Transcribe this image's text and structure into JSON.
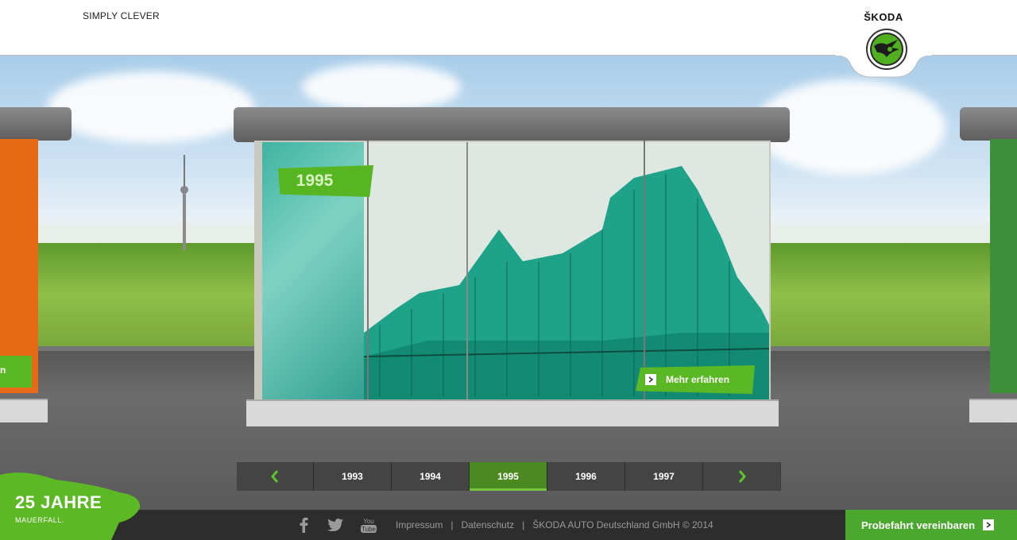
{
  "header": {
    "tagline": "SIMPLY CLEVER",
    "brand": "ŠKODA",
    "emblem_icon": "skoda-winged-arrow-icon"
  },
  "hero": {
    "year": "1995",
    "more_label": "Mehr erfahren",
    "left_tag": "n",
    "accent": "#56b520"
  },
  "year_nav": {
    "prev_icon": "chevron-left-icon",
    "next_icon": "chevron-right-icon",
    "years": [
      "1993",
      "1994",
      "1995",
      "1996",
      "1997"
    ],
    "active": "1995"
  },
  "badge": {
    "title": "25 JAHRE",
    "subtitle": "MAUERFALL."
  },
  "footer": {
    "social": [
      "facebook-icon",
      "twitter-icon",
      "youtube-icon"
    ],
    "youtube_text": "You Tube",
    "links": [
      "Impressum",
      "Datenschutz",
      "ŠKODA AUTO Deutschland GmbH © 2014"
    ],
    "separator": "|",
    "cta_label": "Probefahrt vereinbaren"
  }
}
